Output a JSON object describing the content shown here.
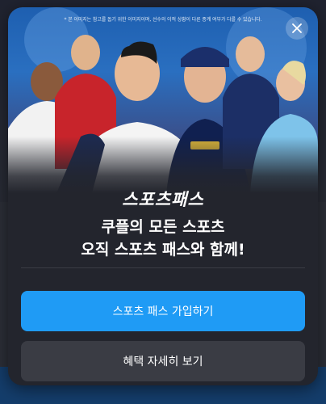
{
  "modal": {
    "disclaimer": "* 본 이미지는 참고를 돕기 위한 이미지이며, 선수의 이적 상황이 다른 종계 여부가 다를 수 있습니다.",
    "close_icon": "close-icon",
    "logo_text": "스포츠패스",
    "headline_line1": "쿠플의 모든 스포츠",
    "headline_line2": "오직 스포츠 패스와 함께!",
    "primary_button_label": "스포츠 패스 가입하기",
    "secondary_button_label": "혜택 자세히 보기"
  },
  "colors": {
    "accent": "#1f9bf5",
    "modal_bg": "#23252d",
    "secondary_button": "#3a3c44"
  }
}
